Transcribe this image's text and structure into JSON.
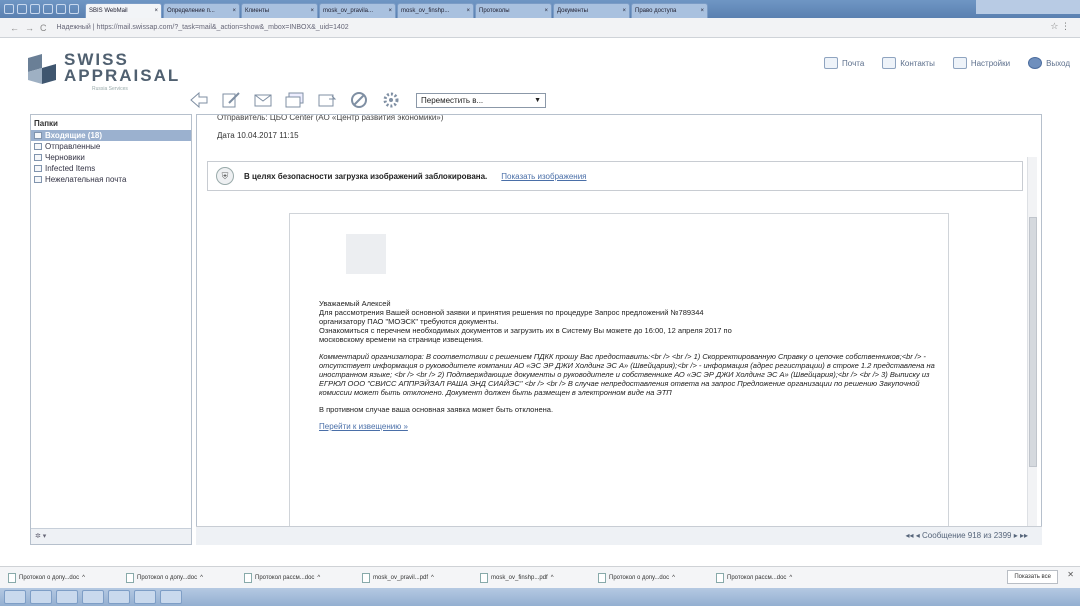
{
  "browser": {
    "tabs": [
      {
        "label": "SBIS WebMail",
        "active": true
      },
      {
        "label": "Определение п..."
      },
      {
        "label": "Клиенты"
      },
      {
        "label": "mosk_ov_pravila..."
      },
      {
        "label": "mosk_ov_finshp..."
      },
      {
        "label": "Протоколы"
      },
      {
        "label": "Документы"
      },
      {
        "label": "Право доступа"
      }
    ],
    "url": "Надежный | https://mail.swissap.com/?_task=mail&_action=show&_mbox=INBOX&_uid=1402",
    "right_icons": "☆ ⋮"
  },
  "app": {
    "logo_line1": "SWISS",
    "logo_line2": "APPRAISAL",
    "logo_sub": "Russia Services",
    "nav": {
      "mail": "Почта",
      "contacts": "Контакты",
      "settings": "Настройки",
      "logout": "Выход"
    }
  },
  "toolbar": {
    "move_to": "Переместить в..."
  },
  "sidebar": {
    "title": "Папки",
    "folders": [
      {
        "label": "Входящие (18)",
        "selected": true
      },
      {
        "label": "Отправленные"
      },
      {
        "label": "Черновики"
      },
      {
        "label": "Infected Items"
      },
      {
        "label": "Нежелательная почта"
      }
    ],
    "footer": "✲ ▾"
  },
  "message": {
    "from": "Отправитель: ЦБО Center (АО «Центр развития экономики»)",
    "date": "Дата 10.04.2017 11:15",
    "security_notice": "В целях безопасности загрузка изображений заблокирована.",
    "show_images": "Показать изображения",
    "greeting": "Уважаемый Алексей",
    "p1_line1": "Для рассмотрения Вашей основной заявки и принятия решения по процедуре Запрос предложений №789344",
    "p1_line2": "организатору ПАО \"МОЭСК\" требуются документы.",
    "p1_line3": "Ознакомиться с перечнем необходимых документов и загрузить их в Систему Вы можете до 16:00, 12 апреля 2017 по",
    "p1_line4": "московскому времени на странице извещения.",
    "comment": "Комментарий организатора: В соответствии с решением ПДКК прошу Вас предоставить:<br /> <br /> 1) Скорректированную Справку о цепочке собственников;<br /> - отсутствует информация о руководителе компании АО «ЭС ЭР ДЖИ Холдинг ЭС А» (Швейцария);<br /> - информация (адрес регистрации) в строке 1.2 представлена на иностранном языке; <br /> <br /> 2) Подтверждающие документы о руководителе и собственнике АО «ЭС ЭР ДЖИ Холдинг ЭС А» (Швейцария);<br /> <br /> 3) Выписку из ЕГРЮЛ ООО \"СВИСС АППРЭЙЗАЛ РАША ЭНД СИАЙЭС\" <br /> <br /> В случае непредоставления ответа на запрос Предложение организации по решению Закупочной комиссии может быть отклонено. Документ должен быть размещен в электронном виде на ЭТП",
    "warning": "В противном случае ваша основная заявка может быть отклонена.",
    "link": "Перейти к извещению »",
    "counter": "◂◂ ◂ Сообщение 918 из 2399 ▸ ▸▸"
  },
  "downloads": {
    "items": [
      "Протокол о допу...doc",
      "Протокол о допу...doc",
      "Протокол рассм...doc",
      "mosk_ov_pravil...pdf",
      "mosk_ov_finshp...pdf",
      "Протокол о допу...doc",
      "Протокол рассм...doc"
    ],
    "show_all": "Показать все",
    "close": "✕"
  },
  "colors": {
    "accent": "#4a6fa8",
    "selected_folder": "#9bb1cf",
    "logo": "#506070"
  }
}
